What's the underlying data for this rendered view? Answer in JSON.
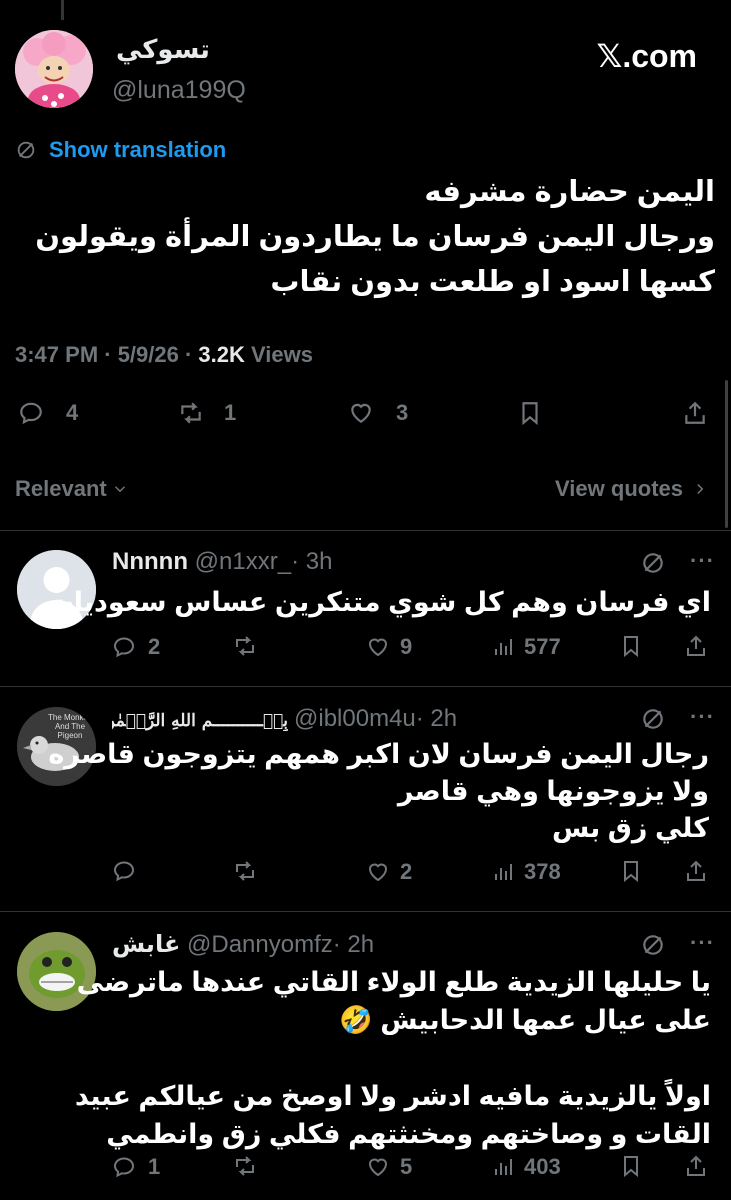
{
  "author": {
    "display_name": "تسوكي",
    "handle": "@luna199Q",
    "brand": "𝕏.com"
  },
  "tweet": {
    "translate_label": "Show translation",
    "lines": [
      "اليمن حضارة مشرفه",
      "ورجال اليمن فرسان ما يطاردون المرأة ويقولون",
      "كسها اسود او طلعت بدون نقاب"
    ],
    "meta_time": "3:47 PM · 5/9/26 · ",
    "meta_views_count": "3.2K",
    "meta_views_label": " Views",
    "stats": {
      "replies": "4",
      "reposts": "1",
      "likes": "3"
    }
  },
  "filters": {
    "sort_label": "Relevant",
    "quotes_label": "View quotes"
  },
  "replies": [
    {
      "name": "Nnnnn",
      "handle": "@n1xxr_",
      "time": "· 3h",
      "lines": [
        "اي فرسان وهم كل شوي متنكرين عساس سعوديات"
      ],
      "reply_count": "2",
      "repost_count": "",
      "like_count": "9",
      "views": "577"
    },
    {
      "name": "بِسۡــــــــــمِ اللهِ الرَّحۡمٰنِ الرَّحِيۡمِ",
      "handle": "@ibl00m4u",
      "time": "· 2h",
      "avatar_text": "The Monkey And The Pigeon",
      "lines": [
        "رجال اليمن فرسان لان اكبر همهم يتزوجون قاصره",
        "ولا يزوجونها وهي قاصر",
        "كلي زق بس"
      ],
      "reply_count": "",
      "repost_count": "",
      "like_count": "2",
      "views": "378"
    },
    {
      "name": "غابش",
      "handle": "@Dannyomfz",
      "time": "· 2h",
      "lines": [
        "يا حليلها الزيدية طلع الولاء القاتي عندها ماترضى",
        "على عيال عمها الدحابيش 🤣",
        "",
        "اولاً يالزيدية مافيه ادشر ولا اوصخ من عيالكم عبيد",
        "القات و وصاختهم ومخنثتهم فكلي زق وانطمي"
      ],
      "reply_count": "1",
      "repost_count": "",
      "like_count": "5",
      "views": "403"
    }
  ],
  "colors": {
    "background": "#000000",
    "text": "#e7e9ea",
    "muted": "#71767b",
    "link": "#1d9bf0",
    "divider": "#2f3336"
  }
}
